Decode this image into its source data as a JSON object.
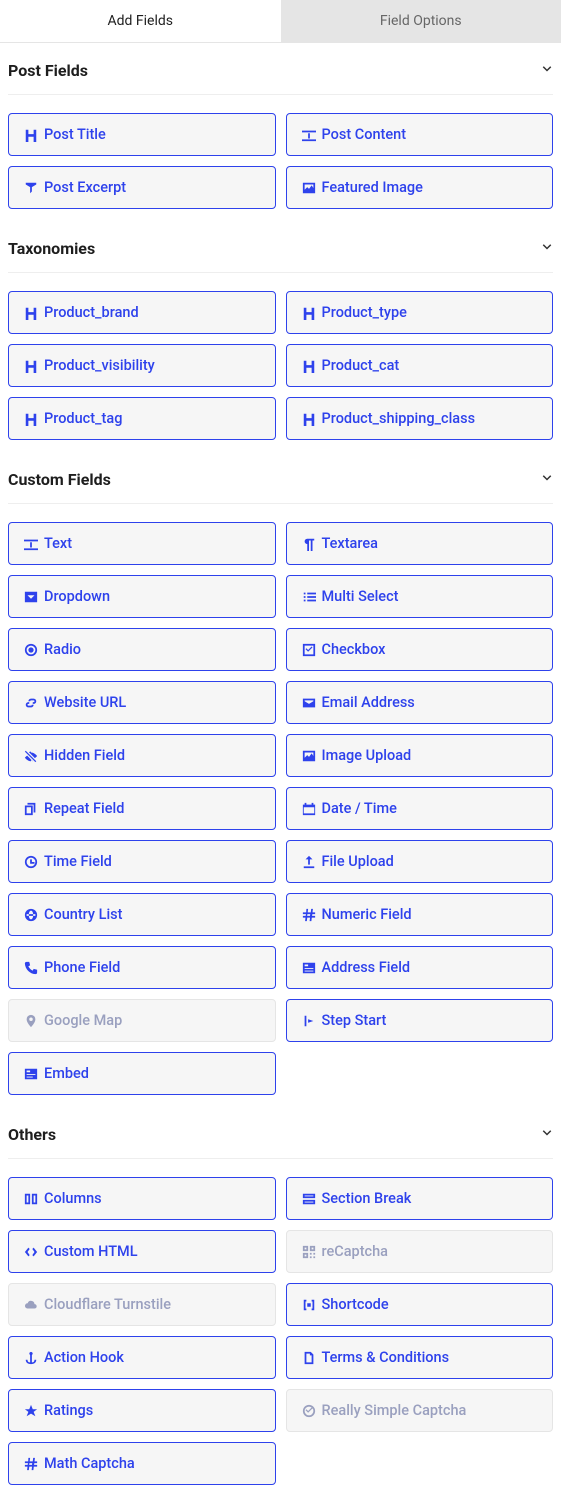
{
  "tabs": {
    "add_fields": "Add Fields",
    "field_options": "Field Options"
  },
  "sections": {
    "post_fields": {
      "title": "Post Fields",
      "items": [
        {
          "icon": "heading",
          "label": "Post Title"
        },
        {
          "icon": "input",
          "label": "Post Content"
        },
        {
          "icon": "pin",
          "label": "Post Excerpt"
        },
        {
          "icon": "image",
          "label": "Featured Image"
        }
      ]
    },
    "taxonomies": {
      "title": "Taxonomies",
      "items": [
        {
          "icon": "heading",
          "label": "Product_brand"
        },
        {
          "icon": "heading",
          "label": "Product_type"
        },
        {
          "icon": "heading",
          "label": "Product_visibility"
        },
        {
          "icon": "heading",
          "label": "Product_cat"
        },
        {
          "icon": "heading",
          "label": "Product_tag"
        },
        {
          "icon": "heading",
          "label": "Product_shipping_class"
        }
      ]
    },
    "custom_fields": {
      "title": "Custom Fields",
      "items": [
        {
          "icon": "input",
          "label": "Text"
        },
        {
          "icon": "paragraph",
          "label": "Textarea"
        },
        {
          "icon": "dropdown",
          "label": "Dropdown"
        },
        {
          "icon": "list",
          "label": "Multi Select"
        },
        {
          "icon": "radio",
          "label": "Radio"
        },
        {
          "icon": "checkbox",
          "label": "Checkbox"
        },
        {
          "icon": "link",
          "label": "Website URL"
        },
        {
          "icon": "envelope",
          "label": "Email Address"
        },
        {
          "icon": "eye-slash",
          "label": "Hidden Field"
        },
        {
          "icon": "image",
          "label": "Image Upload"
        },
        {
          "icon": "copy",
          "label": "Repeat Field"
        },
        {
          "icon": "calendar",
          "label": "Date / Time"
        },
        {
          "icon": "clock",
          "label": "Time Field"
        },
        {
          "icon": "upload",
          "label": "File Upload"
        },
        {
          "icon": "globe",
          "label": "Country List"
        },
        {
          "icon": "hash",
          "label": "Numeric Field"
        },
        {
          "icon": "phone",
          "label": "Phone Field"
        },
        {
          "icon": "address",
          "label": "Address Field"
        },
        {
          "icon": "map-pin",
          "label": "Google Map",
          "disabled": true
        },
        {
          "icon": "step",
          "label": "Step Start"
        },
        {
          "icon": "embed",
          "label": "Embed"
        }
      ]
    },
    "others": {
      "title": "Others",
      "items": [
        {
          "icon": "columns",
          "label": "Columns"
        },
        {
          "icon": "section",
          "label": "Section Break"
        },
        {
          "icon": "code",
          "label": "Custom HTML"
        },
        {
          "icon": "qr",
          "label": "reCaptcha",
          "disabled": true
        },
        {
          "icon": "cloud",
          "label": "Cloudflare Turnstile",
          "disabled": true
        },
        {
          "icon": "shortcode",
          "label": "Shortcode"
        },
        {
          "icon": "anchor",
          "label": "Action Hook"
        },
        {
          "icon": "file",
          "label": "Terms & Conditions"
        },
        {
          "icon": "star",
          "label": "Ratings"
        },
        {
          "icon": "check-circle",
          "label": "Really Simple Captcha",
          "disabled": true
        },
        {
          "icon": "hash",
          "label": "Math Captcha"
        }
      ]
    }
  }
}
